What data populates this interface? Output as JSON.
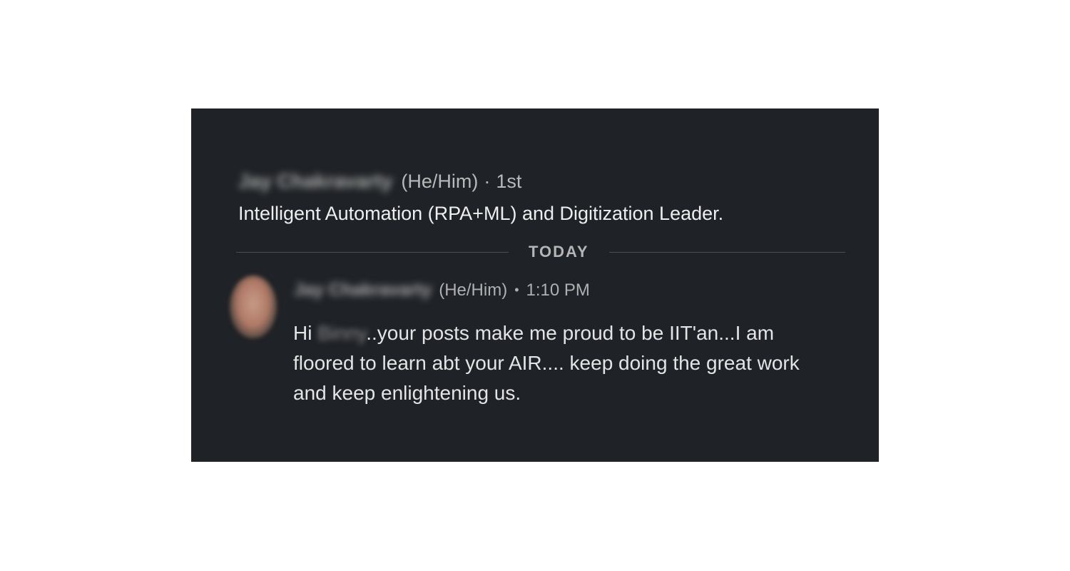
{
  "profile": {
    "name": "Jay Chakravarty",
    "pronouns": "(He/Him)",
    "connection_separator": "·",
    "connection_degree": "1st",
    "headline": "Intelligent Automation (RPA+ML) and Digitization Leader."
  },
  "divider": {
    "label": "TODAY"
  },
  "message": {
    "sender_name": "Jay Chakravarty",
    "pronouns": "(He/Him)",
    "bullet": "•",
    "timestamp": "1:10 PM",
    "greeting": "Hi",
    "recipient_name": "Binny",
    "body_rest": "..your posts make me proud to be IIT'an...I am floored to learn abt your AIR.... keep doing the great work and keep enlightening us."
  },
  "colors": {
    "panel_background": "#1f2226",
    "primary_text": "#eeeeee",
    "secondary_text": "#b0b0b0",
    "divider_line": "#4a4d52"
  }
}
